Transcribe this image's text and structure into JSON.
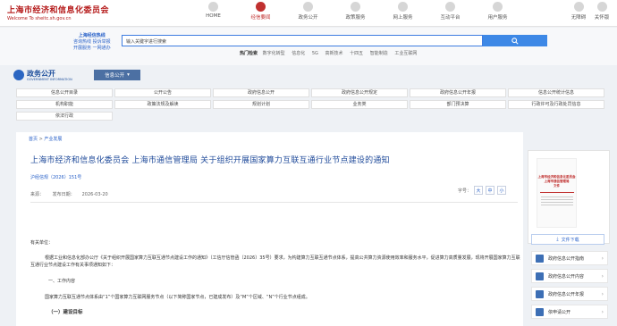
{
  "header": {
    "logo_line1": "上海市经济和信息化委员会",
    "logo_line2": "Welcome To sheitc.sh.gov.cn",
    "nav": [
      "HOME",
      "经信要闻",
      "政务公开",
      "政策服务",
      "网上服务",
      "互动平台",
      "用户服务"
    ],
    "active_nav": 1,
    "utilities": [
      "无障碍",
      "关怀版"
    ]
  },
  "search": {
    "hotline_lines": [
      "上海经信热线",
      "咨询热线  投诉举报",
      "开展服务  一网通办"
    ],
    "placeholder": "输入关键字进行搜索",
    "hot_label": "热门检索",
    "hot_keywords": [
      "数字化转型",
      "信息化",
      "5G",
      "高新技术",
      "十四五",
      "智能制造",
      "工业互联网"
    ]
  },
  "section": {
    "title": "政务公开",
    "subtitle": "GOVERNMENT INFORMATION",
    "tag": "信息公开"
  },
  "categories": [
    "信息公开目录",
    "公开公告",
    "政府信息公开",
    "政府信息公开规定",
    "政府信息公开年报",
    "信息公开统计信息",
    "机构职能",
    "政策法规及解读",
    "规划计划",
    "业务类",
    "部门预决算",
    "行政许可及行政处罚信息",
    "依法行政"
  ],
  "article": {
    "breadcrumb_home": "首页",
    "breadcrumb_sep": ">",
    "breadcrumb_section": "产业发展",
    "title": "上海市经济和信息化委员会 上海市通信管理局 关于组织开展国家算力互联互通行业节点建设的通知",
    "doc_number": "沪经信规（2026）151号",
    "source_label": "来源：",
    "date_label": "发布日期：",
    "date": "2026-03-20",
    "font_label": "字号：",
    "font_sizes": [
      "大",
      "中",
      "小"
    ],
    "greeting": "有关单位：",
    "main_paragraph": "根据工业和信息化部办公厅《关于组织开展国家算力互联互通节点建设工作的通知》（工信厅信管函〔2026〕35号）要求，为构建算力互联互通节点体系，提高公共算力资源使用效率和服务水平，促进算力高质量发展，现将开展国家算力互联互通行业节点建设工作有关事项通知如下：",
    "section1": "一、工作内容",
    "section1_text": "国家算力互联互通节点体系由“1”个国家算力互联网服务节点（以下简称国家节点，已建成发布）及“M”个区域、“N”个行业节点组成。",
    "section1_sub": "（一）建设目标"
  },
  "sidebar": {
    "doc_title_lines": [
      "上海市经济和信息化委员会",
      "上海市通信管理局",
      "文件"
    ],
    "download": "文件下载",
    "items": [
      "政府信息公开指南",
      "政府信息公开内容",
      "政府信息公开年报",
      "依申请公开"
    ]
  },
  "colors": {
    "brand_red": "#c0302f",
    "brand_blue": "#1f4a9a",
    "search_blue": "#3d88e6"
  }
}
